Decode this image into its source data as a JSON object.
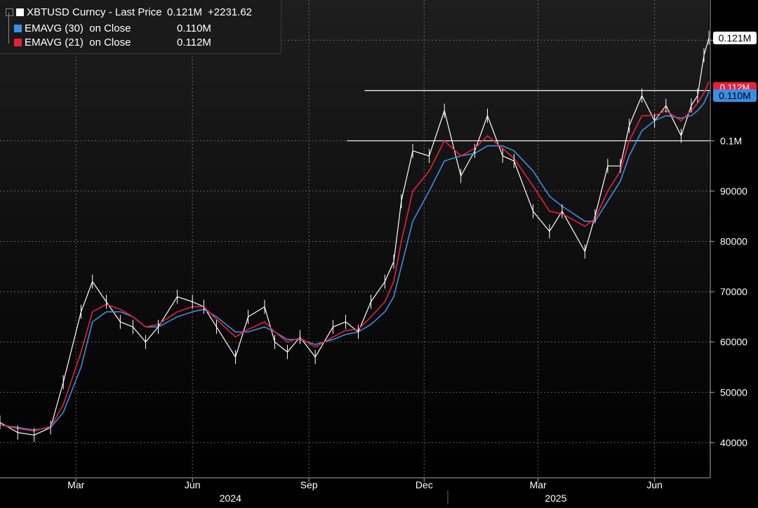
{
  "legend": {
    "items": [
      {
        "name": "XBTUSD Curncy - Last Price",
        "value": "0.121M",
        "change": "+2231.62",
        "color": "#ffffff"
      },
      {
        "name": "EMAVG (30)  on Close",
        "value": "0.110M",
        "color": "#3a8ee6"
      },
      {
        "name": "EMAVG (21)  on Close",
        "value": "0.112M",
        "color": "#e8203a"
      }
    ]
  },
  "badges": {
    "last": "0.121M",
    "ema21": "0.112M",
    "ema30": "0.110M"
  },
  "colors": {
    "background": "#000000",
    "price": "#ffffff",
    "ema30": "#3a8ee6",
    "ema21": "#e8203a",
    "grid": "#8a8a8a",
    "axis_text": "#ffffff"
  },
  "chart_data": {
    "type": "line",
    "title": "",
    "xlabel": "",
    "ylabel": "",
    "ylim": [
      33000,
      128000
    ],
    "grid": true,
    "y_ticks": [
      {
        "value": 40000,
        "label": "40000"
      },
      {
        "value": 50000,
        "label": "50000"
      },
      {
        "value": 60000,
        "label": "60000"
      },
      {
        "value": 70000,
        "label": "70000"
      },
      {
        "value": 80000,
        "label": "80000"
      },
      {
        "value": 90000,
        "label": "90000"
      },
      {
        "value": 100000,
        "label": "0.1M"
      },
      {
        "value": 120000,
        "label": "0.12M"
      }
    ],
    "x_ticks": [
      "Mar",
      "Jun",
      "Sep",
      "Dec",
      "Mar",
      "Jun"
    ],
    "x_tick_dates": [
      "2024-03-01",
      "2024-06-01",
      "2024-09-01",
      "2024-12-01",
      "2025-03-01",
      "2025-06-01"
    ],
    "year_labels": [
      {
        "label": "2024",
        "date": "2024-07-01"
      },
      {
        "label": "2025",
        "date": "2025-03-15"
      }
    ],
    "xlim": [
      "2024-01-01",
      "2025-07-15"
    ],
    "horizontal_lines": [
      {
        "value": 100000,
        "from": "2024-10-01"
      },
      {
        "value": 110000,
        "from": "2024-10-15"
      }
    ],
    "x": [
      "2024-01-01",
      "2024-01-15",
      "2024-01-28",
      "2024-02-10",
      "2024-02-20",
      "2024-03-05",
      "2024-03-14",
      "2024-03-25",
      "2024-04-05",
      "2024-04-15",
      "2024-04-25",
      "2024-05-05",
      "2024-05-20",
      "2024-06-01",
      "2024-06-10",
      "2024-06-20",
      "2024-07-05",
      "2024-07-15",
      "2024-07-28",
      "2024-08-05",
      "2024-08-15",
      "2024-08-25",
      "2024-09-06",
      "2024-09-20",
      "2024-09-30",
      "2024-10-10",
      "2024-10-20",
      "2024-10-31",
      "2024-11-07",
      "2024-11-13",
      "2024-11-22",
      "2024-12-05",
      "2024-12-17",
      "2024-12-30",
      "2025-01-10",
      "2025-01-20",
      "2025-02-01",
      "2025-02-10",
      "2025-02-25",
      "2025-03-10",
      "2025-03-20",
      "2025-04-07",
      "2025-04-15",
      "2025-04-25",
      "2025-05-05",
      "2025-05-12",
      "2025-05-22",
      "2025-06-01",
      "2025-06-10",
      "2025-06-22",
      "2025-06-30",
      "2025-07-05",
      "2025-07-10",
      "2025-07-14"
    ],
    "series": [
      {
        "name": "XBTUSD Curncy - Last Price",
        "values": [
          44000,
          42000,
          41500,
          43000,
          52000,
          66000,
          72000,
          68000,
          64000,
          63000,
          60000,
          63000,
          69000,
          68000,
          67000,
          63000,
          57000,
          65000,
          67000,
          60000,
          58000,
          61000,
          57000,
          63000,
          64000,
          62000,
          68000,
          72000,
          76000,
          88000,
          98000,
          97000,
          106000,
          93000,
          98000,
          105000,
          97000,
          96000,
          86000,
          82000,
          86000,
          78000,
          85000,
          95000,
          95000,
          103000,
          109000,
          104000,
          107000,
          101000,
          107000,
          109000,
          117000,
          120500
        ]
      },
      {
        "name": "EMAVG (30)  on Close",
        "values": [
          43500,
          43000,
          42500,
          43000,
          46000,
          55000,
          64000,
          66000,
          66000,
          65000,
          63000,
          63000,
          65000,
          66000,
          66500,
          65000,
          62000,
          62000,
          63000,
          62000,
          60500,
          60500,
          59500,
          60500,
          61500,
          62000,
          63500,
          66000,
          69000,
          75000,
          84000,
          90000,
          96000,
          97000,
          97500,
          99000,
          99000,
          98000,
          94000,
          89000,
          87000,
          84000,
          84000,
          88000,
          92000,
          97000,
          102000,
          104000,
          105000,
          104500,
          105000,
          106000,
          107500,
          109800
        ]
      },
      {
        "name": "EMAVG (21)  on Close",
        "values": [
          43500,
          42800,
          42300,
          43200,
          47500,
          58000,
          66000,
          67500,
          66500,
          65000,
          63000,
          63500,
          66000,
          67000,
          67000,
          64500,
          61000,
          62500,
          64000,
          62000,
          60000,
          60800,
          59000,
          61000,
          62300,
          62500,
          65000,
          68000,
          72000,
          80000,
          90000,
          94000,
          100000,
          97000,
          98500,
          101000,
          98500,
          96500,
          91000,
          86000,
          85500,
          83000,
          84500,
          90000,
          94000,
          100000,
          105000,
          105000,
          106000,
          104000,
          106000,
          107500,
          109500,
          111800
        ]
      }
    ]
  }
}
